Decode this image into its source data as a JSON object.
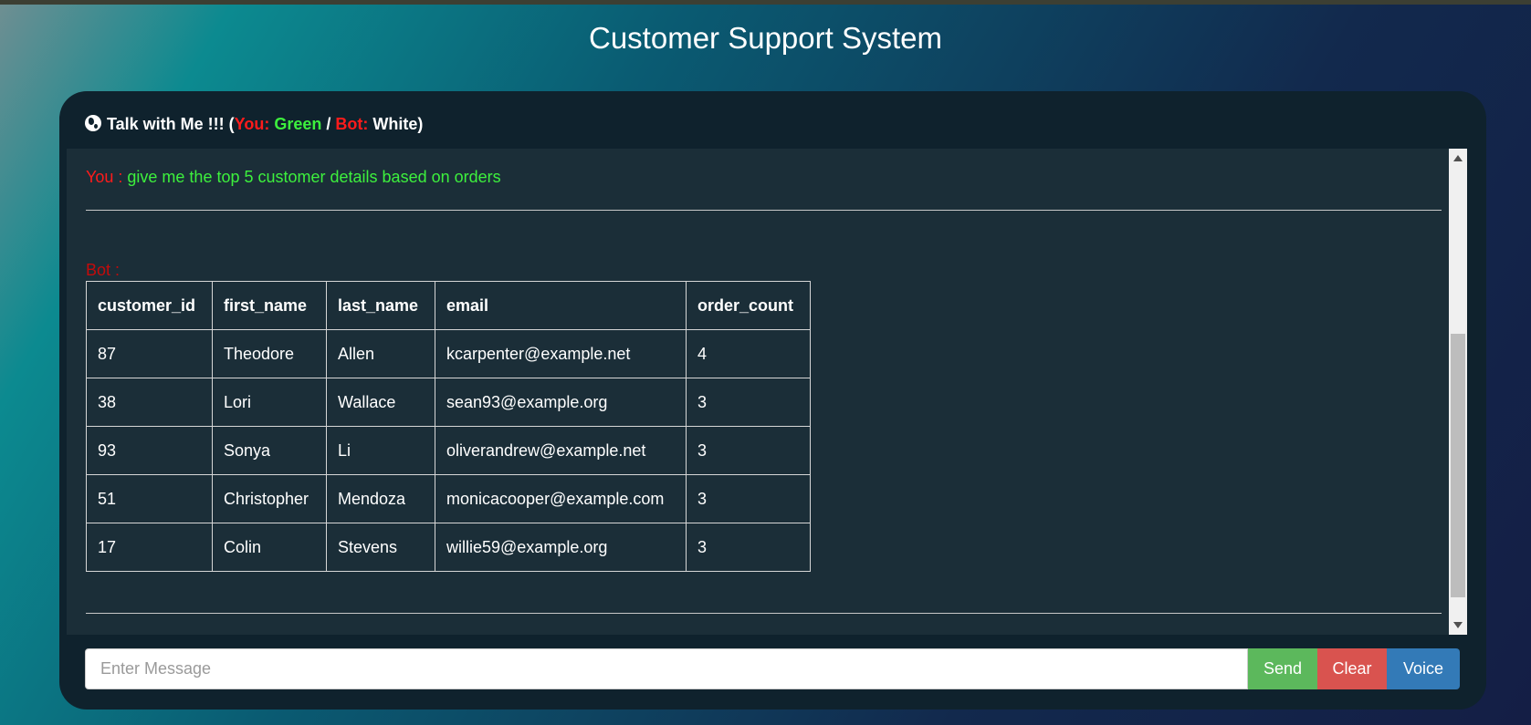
{
  "page": {
    "title": "Customer Support System"
  },
  "chat": {
    "header": {
      "title": "Talk with Me !!! (",
      "you_label": "You:",
      "you_color_name": "Green",
      "separator": "/",
      "bot_label": "Bot:",
      "bot_color_name": "White)"
    },
    "messages": [
      {
        "sender": "You :",
        "text": "give me the top 5 customer details based on orders"
      },
      {
        "sender": "Bot :"
      }
    ],
    "table": {
      "columns": [
        "customer_id",
        "first_name",
        "last_name",
        "email",
        "order_count"
      ],
      "rows": [
        [
          "87",
          "Theodore",
          "Allen",
          "kcarpenter@example.net",
          "4"
        ],
        [
          "38",
          "Lori",
          "Wallace",
          "sean93@example.org",
          "3"
        ],
        [
          "93",
          "Sonya",
          "Li",
          "oliverandrew@example.net",
          "3"
        ],
        [
          "51",
          "Christopher",
          "Mendoza",
          "monicacooper@example.com",
          "3"
        ],
        [
          "17",
          "Colin",
          "Stevens",
          "willie59@example.org",
          "3"
        ]
      ]
    },
    "input": {
      "placeholder": "Enter Message",
      "value": ""
    },
    "buttons": {
      "send": "Send",
      "clear": "Clear",
      "voice": "Voice"
    }
  },
  "colors": {
    "you_label": "#ff1b1b",
    "you_text": "#3df03d",
    "bot_label": "#c40b0b",
    "send": "#5cb85c",
    "clear": "#d9534f",
    "voice": "#337ab7"
  },
  "icons": {
    "header": "globe-icon"
  }
}
